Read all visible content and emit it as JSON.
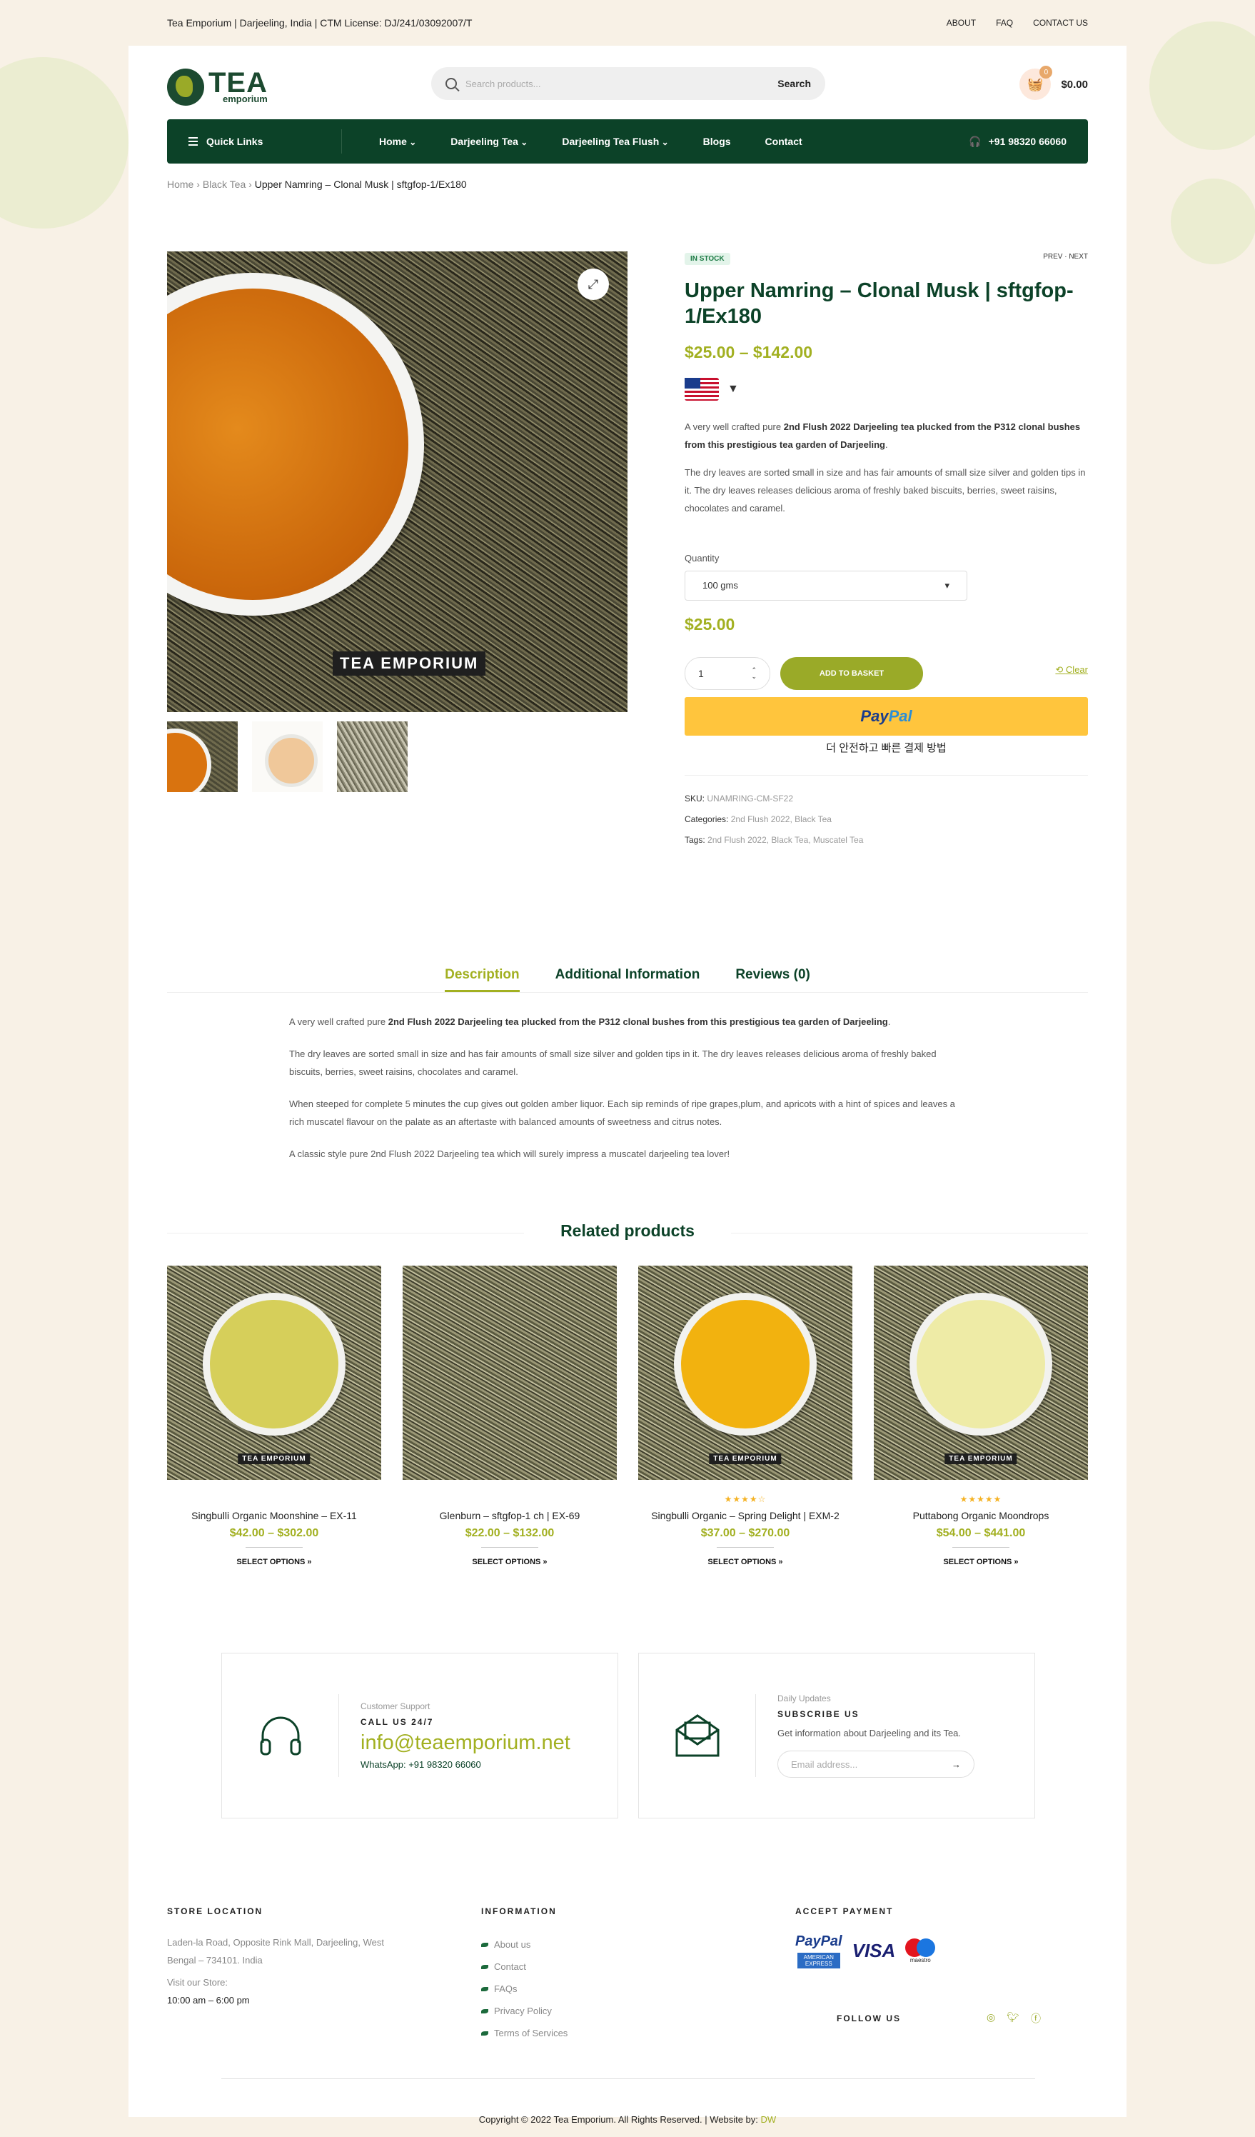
{
  "topbar": {
    "text": "Tea Emporium | Darjeeling, India | CTM License: DJ/241/03092007/T",
    "links": [
      "ABOUT",
      "FAQ",
      "CONTACT US"
    ]
  },
  "header": {
    "logo_big": "TEA",
    "logo_small": "emporium",
    "search_placeholder": "Search products...",
    "search_button": "Search",
    "cart_count": "0",
    "cart_total": "$0.00"
  },
  "nav": {
    "quick_links": "Quick Links",
    "items": [
      "Home",
      "Darjeeling Tea",
      "Darjeeling Tea Flush",
      "Blogs",
      "Contact"
    ],
    "phone": "+91 98320 66060"
  },
  "breadcrumb": {
    "home": "Home",
    "category": "Black Tea",
    "current": "Upper Namring – Clonal Musk | sftgfop-1/Ex180"
  },
  "gallery": {
    "brand": "TEA EMPORIUM"
  },
  "product": {
    "stock": "IN STOCK",
    "prev": "PREV",
    "next": "NEXT",
    "title": "Upper Namring – Clonal Musk | sftgfop-1/Ex180",
    "price_range": "$25.00 – $142.00",
    "short_desc_1_pre": "A very well crafted pure ",
    "short_desc_1_bold": "2nd Flush 2022 Darjeeling tea plucked from the P312 clonal bushes from this prestigious tea garden of Darjeeling",
    "short_desc_1_post": ".",
    "short_desc_2": "The dry leaves are sorted small in size and has fair amounts of small size silver and golden tips in it. The dry leaves releases delicious aroma of freshly baked biscuits, berries, sweet raisins, chocolates and caramel.",
    "quantity_label": "Quantity",
    "quantity_option": "100 gms",
    "clear": "Clear",
    "variation_price": "$25.00",
    "qty_value": "1",
    "add_to_basket": "ADD TO BASKET",
    "paypal_a": "Pay",
    "paypal_b": "Pal",
    "paypal_sub": "더 안전하고 빠른 결제 방법",
    "sku_label": "SKU:",
    "sku": "UNAMRING-CM-SF22",
    "categories_label": "Categories:",
    "categories": "2nd Flush 2022, Black Tea",
    "tags_label": "Tags:",
    "tags": "2nd Flush 2022, Black Tea, Muscatel Tea"
  },
  "tabs": [
    "Description",
    "Additional Information",
    "Reviews (0)"
  ],
  "description": {
    "p1_pre": "A very well crafted pure ",
    "p1_bold": "2nd Flush 2022 Darjeeling tea plucked from the P312 clonal bushes from this prestigious tea garden of Darjeeling",
    "p1_post": ".",
    "p2": "The dry leaves are sorted small in size and has fair amounts of small size silver and golden tips in it. The dry leaves releases delicious aroma of freshly baked biscuits, berries, sweet raisins, chocolates and caramel.",
    "p3": "When steeped for complete 5 minutes the cup gives out golden amber liquor. Each sip reminds of ripe grapes,plum, and apricots with a hint of spices and leaves a rich muscatel flavour on the palate as an aftertaste with balanced amounts of sweetness and citrus notes.",
    "p4": "A classic style pure 2nd Flush 2022 Darjeeling tea which will surely impress a muscatel darjeeling tea lover!"
  },
  "related": {
    "heading": "Related products",
    "badge": "TEA EMPORIUM",
    "select": "SELECT OPTIONS »",
    "items": [
      {
        "name": "Singbulli Organic Moonshine – EX-11",
        "price": "$42.00 – $302.00",
        "stars": "",
        "cup": "#d6cf5a"
      },
      {
        "name": "Glenburn – sftgfop-1 ch | EX-69",
        "price": "$22.00 – $132.00",
        "stars": "",
        "cup": ""
      },
      {
        "name": "Singbulli Organic – Spring Delight | EXM-2",
        "price": "$37.00 – $270.00",
        "stars": "★★★★☆",
        "cup": "#f2b20f"
      },
      {
        "name": "Puttabong Organic Moondrops",
        "price": "$54.00 – $441.00",
        "stars": "★★★★★",
        "cup": "#eeeba6"
      }
    ]
  },
  "support": {
    "kicker": "Customer Support",
    "heading": "CALL US 24/7",
    "email": "info@teaemporium.net",
    "whatsapp": "WhatsApp: +91 98320 66060"
  },
  "subscribe": {
    "kicker": "Daily Updates",
    "heading": "SUBSCRIBE US",
    "text": "Get information about Darjeeling and its Tea.",
    "placeholder": "Email address...",
    "arrow": "→"
  },
  "footer": {
    "store_heading": "STORE LOCATION",
    "address": "Laden-la Road, Opposite Rink Mall, Darjeeling, West Bengal – 734101. India",
    "visit_label": "Visit our Store:",
    "hours": "10:00 am – 6:00 pm",
    "info_heading": "INFORMATION",
    "info_links": [
      "About us",
      "Contact",
      "FAQs",
      "Privacy Policy",
      "Terms of Services"
    ],
    "payment_heading": "ACCEPT PAYMENT",
    "pay_paypal": "PayPal",
    "pay_visa": "VISA",
    "pay_maestro": "maestro",
    "pay_amex": "AMERICAN EXPRESS",
    "follow": "FOLLOW US",
    "copyright": "Copyright © 2022 Tea Emporium. All Rights Reserved.   |   Website by: ",
    "credit": "DW"
  },
  "colors": {
    "brand_green": "#0c4228",
    "accent": "#a2b021",
    "paypal": "#ffc53d"
  }
}
